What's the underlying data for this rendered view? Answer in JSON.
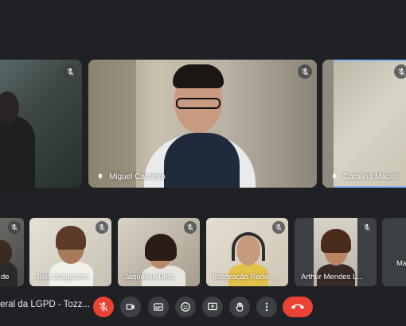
{
  "meeting": {
    "title": "eral da LGPD - Tozz..."
  },
  "main_tiles": [
    {
      "name": "",
      "mic": "mic-off-icon"
    },
    {
      "name": "Miguel Carneiro",
      "pinned": true,
      "mic": "mic-off-icon"
    },
    {
      "name": "Carolina Maciel",
      "pinned": true,
      "mic": "mic-off-icon",
      "active_speaker": true
    }
  ],
  "strip_tiles": [
    {
      "name": "de"
    },
    {
      "name": "Julia Jungmann"
    },
    {
      "name": "Jaqueline Brito"
    },
    {
      "name": "Integração Rede ..."
    },
    {
      "name": "Arthur Mendes L..."
    },
    {
      "name": "Ma"
    }
  ],
  "controls": {
    "mic": "mic-off-icon",
    "camera": "camera-icon",
    "captions": "captions-icon",
    "emoji": "emoji-icon",
    "present": "present-screen-icon",
    "hand": "raise-hand-icon",
    "more": "more-options-icon",
    "leave": "leave-call-icon"
  },
  "colors": {
    "background": "#202124",
    "tile": "#3c4043",
    "danger": "#ea4335",
    "active_border": "#8ab4f8"
  }
}
